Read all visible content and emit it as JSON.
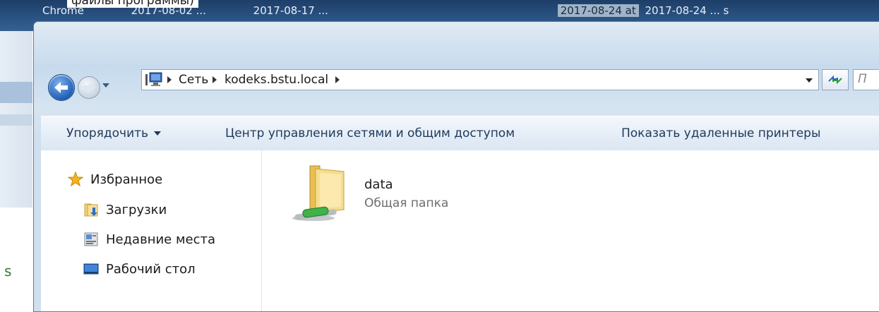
{
  "background": {
    "top_text": "файлы программы)",
    "strip_items": [
      "Chrome",
      "2017-08-02 ...",
      "2017-08-17 ...",
      "2017-08-24 at",
      "2017-08-24 ... s"
    ],
    "left_char": "s"
  },
  "address_bar": {
    "crumbs": [
      "Сеть",
      "kodeks.bstu.local"
    ],
    "search_placeholder": "П"
  },
  "toolbar": {
    "organize_label": "Упорядочить",
    "network_center_label": "Центр управления сетями и общим доступом",
    "printers_label": "Показать удаленные принтеры"
  },
  "navigation_pane": {
    "favorites_label": "Избранное",
    "items": [
      {
        "label": "Загрузки",
        "icon": "downloads-folder-icon"
      },
      {
        "label": "Недавние места",
        "icon": "recent-places-icon"
      },
      {
        "label": "Рабочий стол",
        "icon": "desktop-icon"
      }
    ]
  },
  "content": {
    "items": [
      {
        "name": "data",
        "type": "Общая папка",
        "icon": "shared-folder-icon"
      }
    ]
  },
  "colors": {
    "toolbar_text": "#1e395b",
    "accent_blue": "#1e5eb6"
  }
}
